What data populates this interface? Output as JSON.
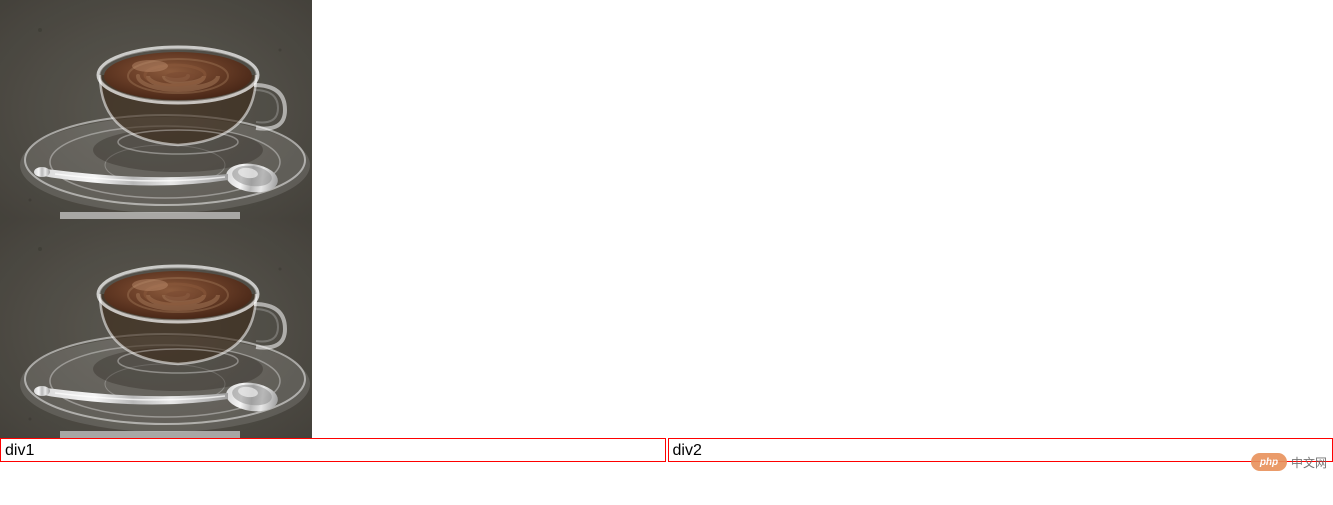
{
  "images": [
    {
      "alt": "coffee cup with spoon on saucer"
    },
    {
      "alt": "coffee cup with spoon on saucer"
    }
  ],
  "boxes": [
    {
      "label": "div1"
    },
    {
      "label": "div2"
    }
  ],
  "watermark": {
    "logo_text": "php",
    "text": "中文网"
  }
}
